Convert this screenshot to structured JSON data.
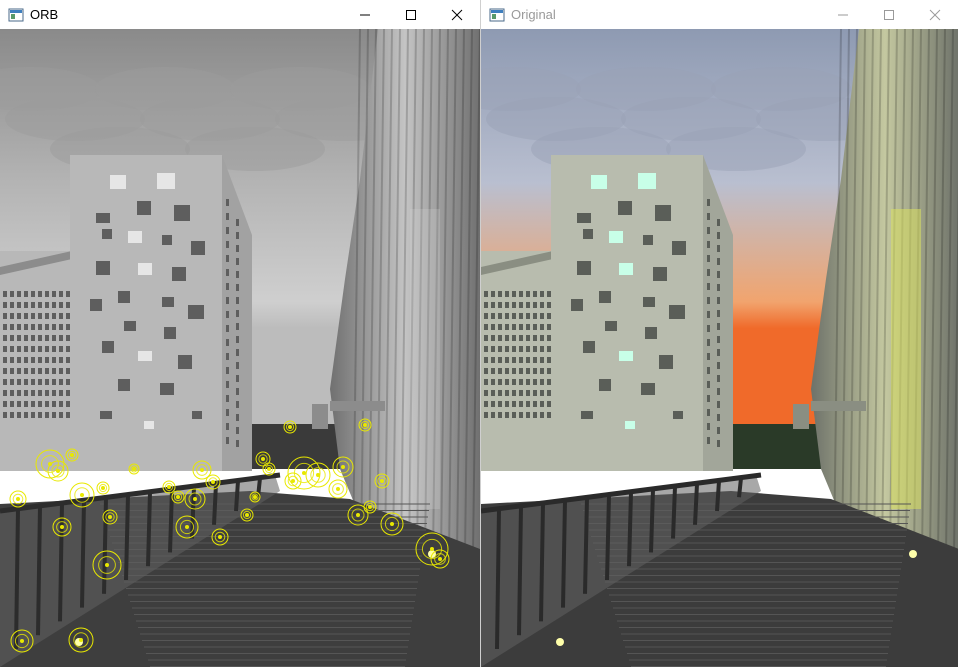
{
  "windows": [
    {
      "title": "ORB",
      "state": "active",
      "image": {
        "mode": "grayscale",
        "overlay": "orb-keypoints",
        "keypoint_color": "#e8e800"
      },
      "controls": [
        "minimize-icon",
        "maximize-icon",
        "close-icon"
      ]
    },
    {
      "title": "Original",
      "state": "inactive",
      "image": {
        "mode": "color",
        "overlay": "none"
      },
      "controls": [
        "minimize-icon",
        "maximize-icon",
        "close-icon"
      ]
    }
  ],
  "colors": {
    "keypoint": "#e8e800",
    "sunset_orange": "#f0a070",
    "sky_blue": "#a8b4c8"
  }
}
